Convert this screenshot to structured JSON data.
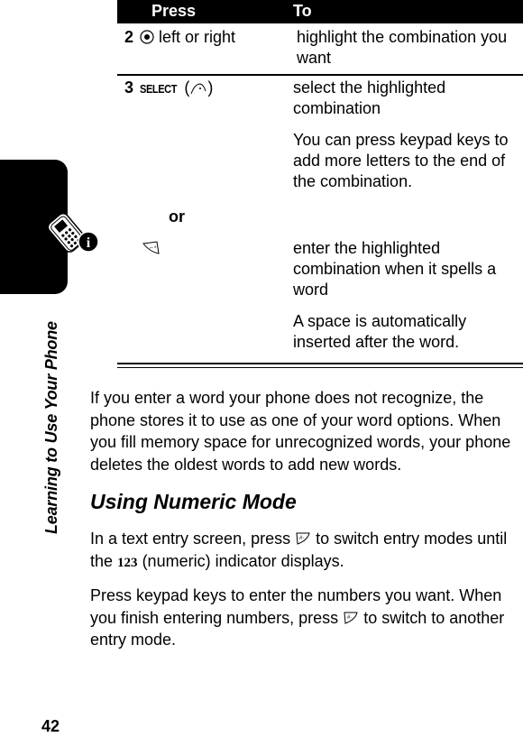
{
  "side": {
    "section_label": "Learning to Use Your Phone",
    "page_number": "42"
  },
  "table": {
    "headers": {
      "press": "Press",
      "to": "To"
    },
    "rows": [
      {
        "step": "2",
        "press_icon": "nav-key-icon",
        "press_text": "left or right",
        "to": [
          "highlight the combination you want"
        ]
      },
      {
        "step": "3",
        "press_key": "SELECT",
        "press_icon": "right-soft-key-icon",
        "to": [
          "select the highlighted combination",
          "You can press keypad keys to add more letters to the end of the combination."
        ]
      },
      {
        "connector": "or",
        "press_icon": "star-key-icon",
        "to": [
          "enter the highlighted combination when it spells a word",
          "A space is automatically inserted after the word."
        ]
      }
    ]
  },
  "body": {
    "paragraph_1": "If you enter a word your phone does not recognize, the phone stores it to use as one of your word options. When you fill memory space for unrecognized words, your phone deletes the oldest words to add new words.",
    "heading": "Using Numeric Mode",
    "paragraph_2_a": "In a text entry screen, press",
    "paragraph_2_b": "to switch entry modes until the",
    "paragraph_2_indicator": "123",
    "paragraph_2_c": "(numeric) indicator displays.",
    "paragraph_3_a": "Press keypad keys to enter the numbers you want. When you finish entering numbers, press",
    "paragraph_3_b": "to switch to another entry mode.",
    "mode_key_icon": "mode-key-icon"
  }
}
